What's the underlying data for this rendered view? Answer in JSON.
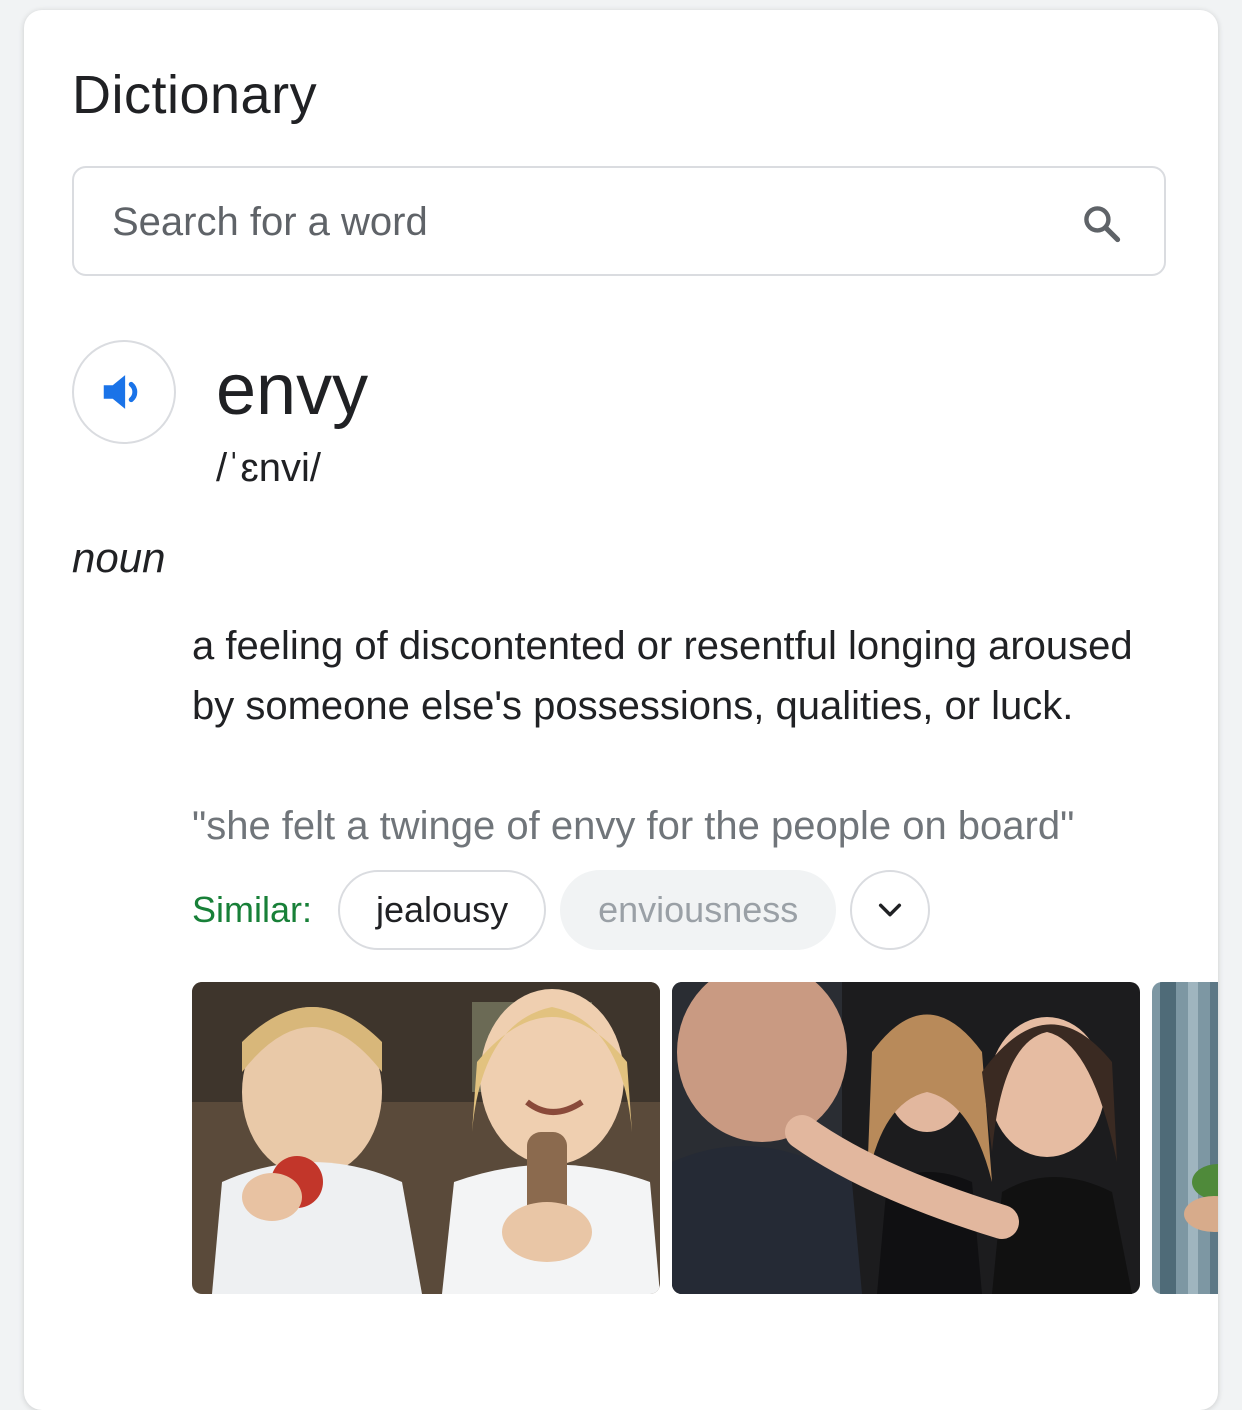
{
  "card": {
    "title": "Dictionary"
  },
  "search": {
    "placeholder": "Search for a word",
    "icon": "search-icon"
  },
  "entry": {
    "audio_icon": "speaker-icon",
    "word": "envy",
    "phonetic": "/ˈɛnvi/",
    "part_of_speech": "noun",
    "definition": "a feeling of discontented or resentful longing aroused by someone else's possessions, qualities, or luck.",
    "example": "\"she felt a twinge of envy for the people on board\"",
    "similar_label": "Similar:",
    "similar": [
      "jealousy",
      "enviousness"
    ],
    "expand_icon": "chevron-down-icon"
  },
  "colors": {
    "similar_label": "#188038",
    "speaker_icon": "#1a73e8",
    "muted_text": "#70757a"
  }
}
